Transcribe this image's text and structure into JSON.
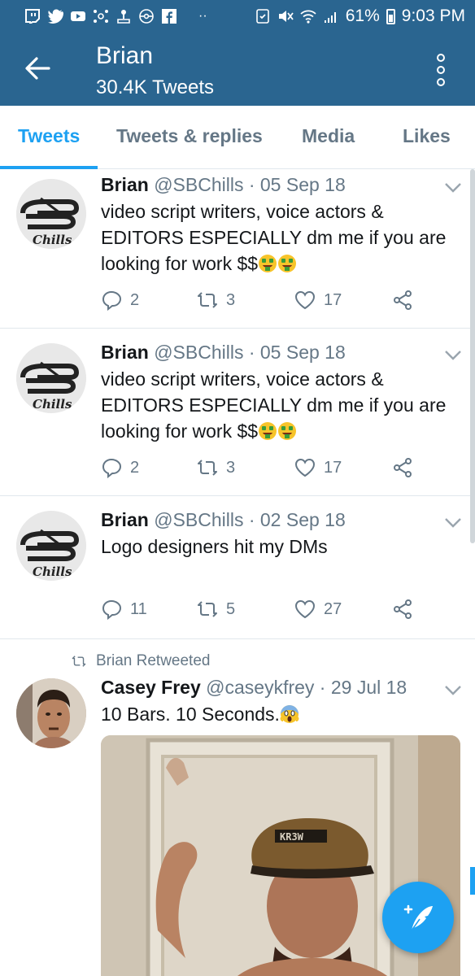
{
  "status_bar": {
    "battery": "61%",
    "time": "9:03 PM",
    "dots": "··",
    "icons": [
      "twitch-icon",
      "twitter-icon",
      "youtube-icon",
      "network-icon",
      "joystick-icon",
      "pokeball-icon",
      "facebook-icon",
      "sync-icon",
      "mute-icon",
      "wifi-icon",
      "signal-icon",
      "battery-icon"
    ]
  },
  "header": {
    "title": "Brian",
    "subtitle": "30.4K Tweets",
    "color": "#2a6590"
  },
  "tabs": [
    {
      "label": "Tweets",
      "active": true
    },
    {
      "label": "Tweets & replies",
      "active": false
    },
    {
      "label": "Media",
      "active": false
    },
    {
      "label": "Likes",
      "active": false
    }
  ],
  "tweets": [
    {
      "name": "Brian",
      "meta": "@SBChills · 05 Sep 18",
      "text": "video script writers, voice actors & EDITORS ESPECIALLY dm me if you are looking for work $$",
      "reply_count": "2",
      "retweet_count": "3",
      "like_count": "17"
    },
    {
      "name": "Brian",
      "meta": "@SBChills · 05 Sep 18",
      "text": "video script writers, voice actors & EDITORS ESPECIALLY dm me if you are looking for work $$",
      "reply_count": "2",
      "retweet_count": "3",
      "like_count": "17"
    },
    {
      "name": "Brian",
      "meta": "@SBChills · 02 Sep 18",
      "text": "Logo designers hit my DMs",
      "reply_count": "11",
      "retweet_count": "5",
      "like_count": "27"
    },
    {
      "retweet_label": "Brian Retweeted",
      "name": "Casey Frey",
      "meta": "@caseykfrey · 29 Jul 18",
      "text": "10 Bars. 10 Seconds.",
      "hat_text": "KR3W"
    }
  ],
  "avatar_text": "Chills",
  "accent": "#1da1f2",
  "fab_icon": "compose-tweet-icon"
}
